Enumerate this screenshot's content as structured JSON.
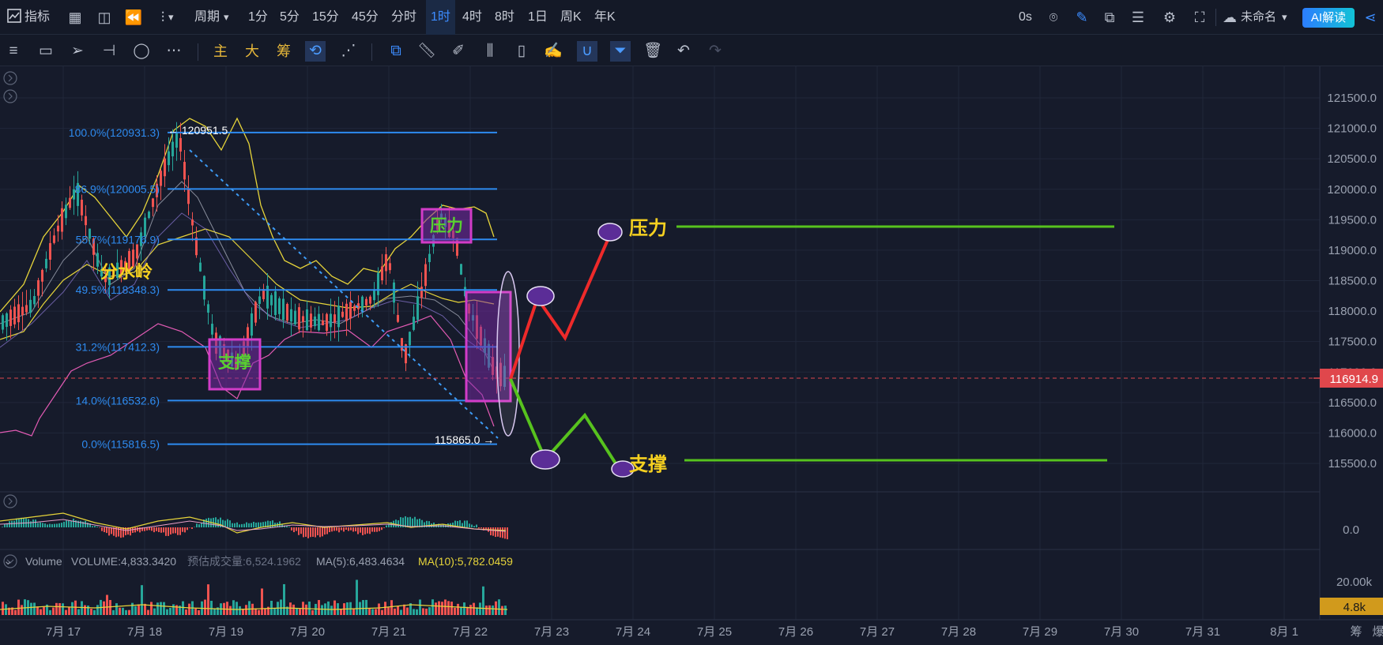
{
  "topbar": {
    "indicator_label": "指标",
    "period_label": "周期",
    "timeframes": [
      "1分",
      "5分",
      "15分",
      "45分",
      "分时",
      "1时",
      "4时",
      "8时",
      "1日",
      "周K",
      "年K"
    ],
    "active_timeframe": "1时",
    "latency": "0s",
    "layout_name": "未命名",
    "ai_button": "AI解读"
  },
  "toolbar2": {
    "text_tools": [
      "主",
      "大",
      "筹"
    ]
  },
  "price_axis": {
    "ticks": [
      "121500.0",
      "121000.0",
      "120500.0",
      "120000.0",
      "119500.0",
      "119000.0",
      "118500.0",
      "118000.0",
      "117500.0",
      "117000.0",
      "116500.0",
      "116000.0",
      "115500.0"
    ],
    "current_price": "116914.9"
  },
  "fibonacci": {
    "levels": [
      "100.0%(120931.3)",
      "86.9%(120005.5)",
      "55.7%(119176.9)",
      "49.5%(118348.3)",
      "31.2%(117412.3)",
      "14.0%(116532.6)",
      "0.0%(115816.5)"
    ],
    "high_label": "← 120951.5",
    "low_label": "115865.0 →"
  },
  "annotations": {
    "watershed": "分水岭",
    "support": "支撑",
    "resistance": "压力"
  },
  "macd_axis": "0.0",
  "volume": {
    "title": "Volume",
    "volume_text": "VOLUME:4,833.3420",
    "estimate_text": "预估成交量:6,524.1962",
    "ma5_text": "MA(5):6,483.4634",
    "ma10_text": "MA(10):5,782.0459",
    "axis_max": "20.00k",
    "current": "4.8k"
  },
  "time_axis": [
    "7月 17",
    "7月 18",
    "7月 19",
    "7月 20",
    "7月 21",
    "7月 22",
    "7月 23",
    "7月 24",
    "7月 25",
    "7月 26",
    "7月 27",
    "7月 28",
    "7月 29",
    "7月 30",
    "7月 31",
    "8月 1"
  ],
  "bottom_right": [
    "筹",
    "爆"
  ],
  "colors": {
    "background": "#161b2b",
    "up": "#26a69a",
    "down": "#ef5350",
    "fib_line": "#2e8bf0",
    "annotation_yellow": "#f5d020",
    "support_green": "#57c21e",
    "resistance_red": "#ee2a2a",
    "highlight_box": "#c735c2"
  }
}
